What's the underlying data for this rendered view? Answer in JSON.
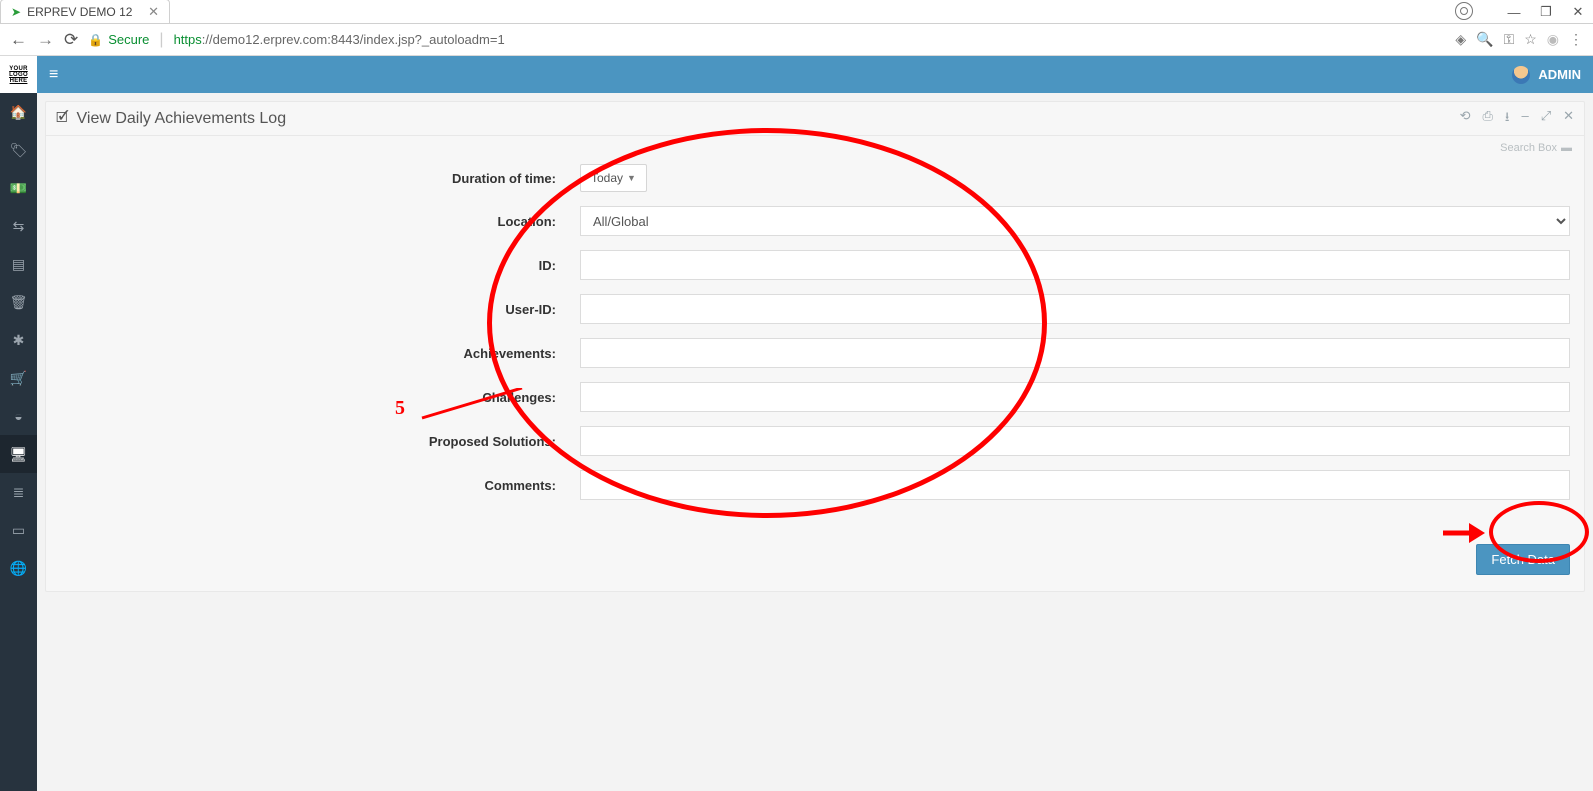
{
  "browser": {
    "tab_title": "ERPREV DEMO 12",
    "secure_label": "Secure",
    "url_proto": "https",
    "url_rest": "://demo12.erprev.com:8443/index.jsp?_autoloadm=1"
  },
  "topbar": {
    "username": "ADMIN"
  },
  "logo": {
    "l1": "YOUR",
    "l2": "LOGO",
    "l3": "HERE"
  },
  "panel": {
    "title": "View Daily Achievements Log",
    "search_box_label": "Search Box"
  },
  "form": {
    "duration_label": "Duration of time:",
    "duration_value": "Today",
    "location_label": "Location:",
    "location_value": "All/Global",
    "id_label": "ID:",
    "id_value": "",
    "userid_label": "User-ID:",
    "userid_value": "",
    "achievements_label": "Achievements:",
    "achievements_value": "",
    "challenges_label": "Challenges:",
    "challenges_value": "",
    "solutions_label": "Proposed Solutions:",
    "solutions_value": "",
    "comments_label": "Comments:",
    "comments_value": "",
    "fetch_label": "Fetch Data"
  },
  "annotation": {
    "number": "5"
  }
}
